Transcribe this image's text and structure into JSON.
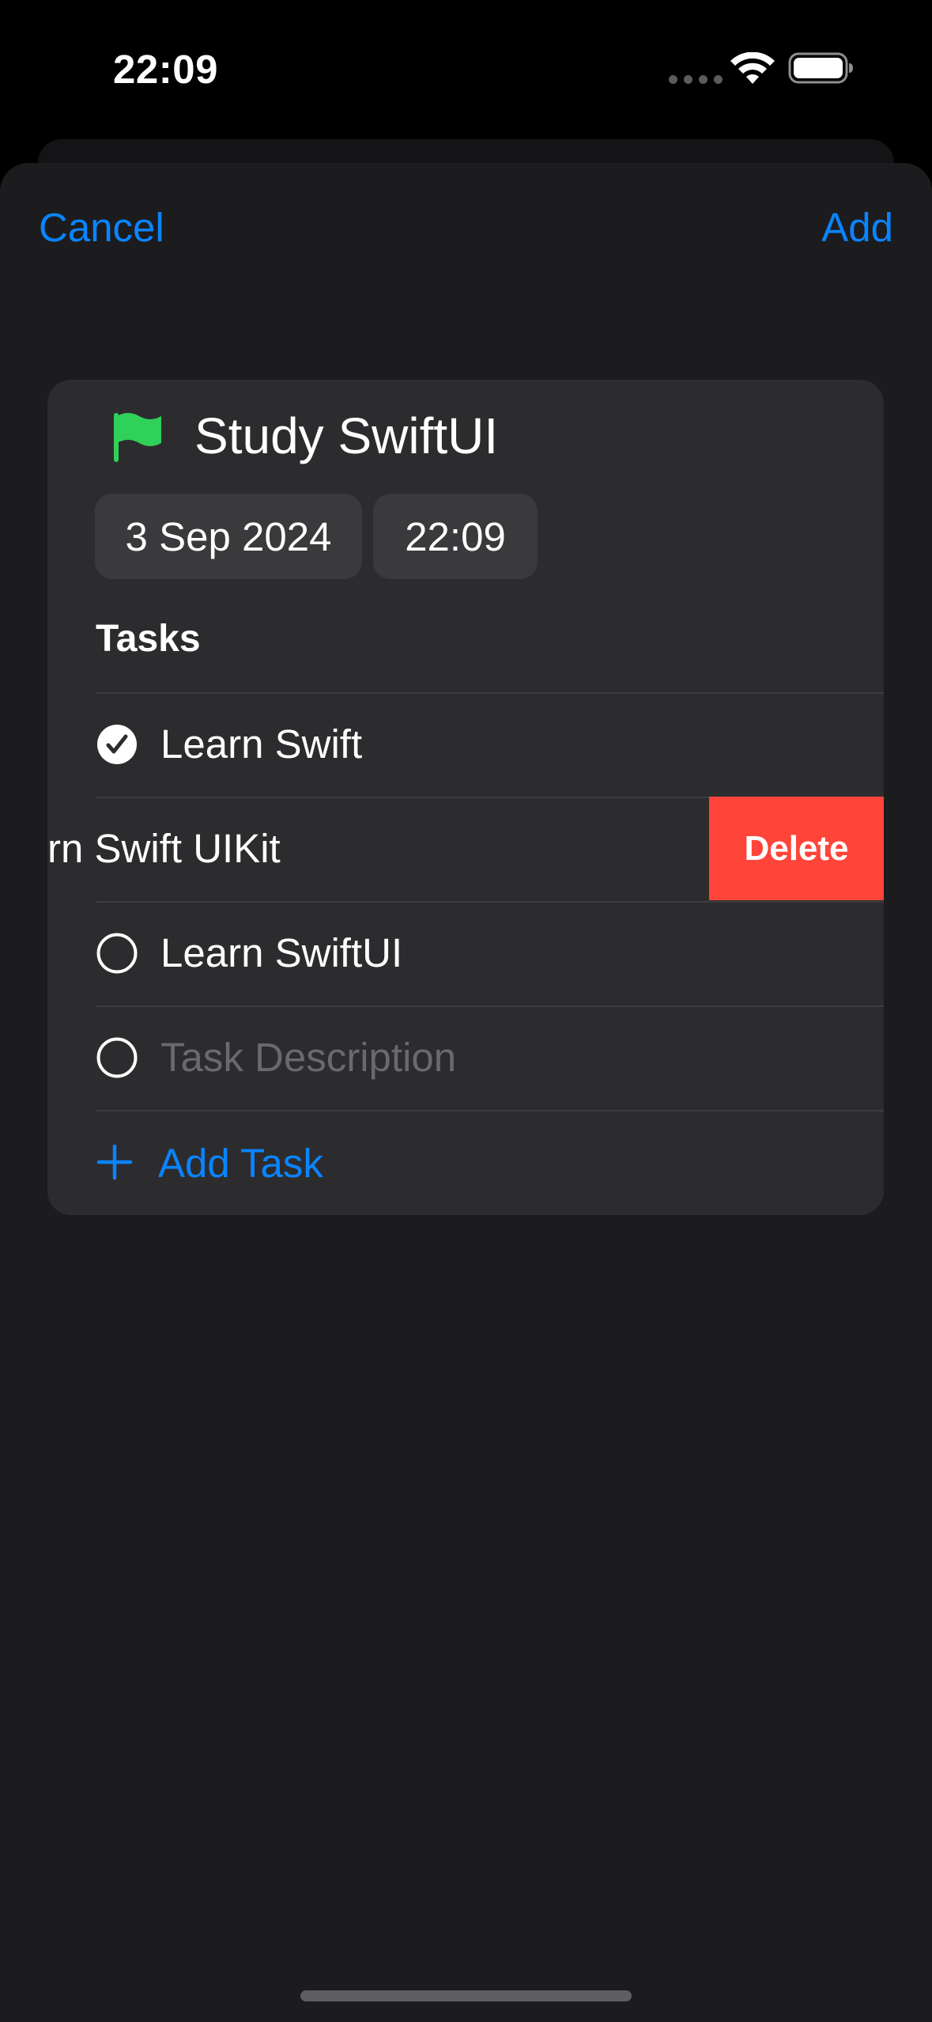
{
  "status_bar": {
    "time": "22:09",
    "icons": [
      "signal-dots-icon",
      "wifi-icon",
      "battery-icon"
    ]
  },
  "nav": {
    "cancel_label": "Cancel",
    "add_label": "Add"
  },
  "list": {
    "title": "Study SwiftUI",
    "flag_icon": "flag-icon",
    "flag_color": "#30d158",
    "date": "3 Sep 2024",
    "time": "22:09"
  },
  "tasks": {
    "section_title": "Tasks",
    "items": [
      {
        "label": "Learn Swift",
        "done": true
      },
      {
        "label": "rn Swift UIKit",
        "swiped": true,
        "delete_label": "Delete"
      },
      {
        "label": "Learn SwiftUI",
        "done": false
      }
    ],
    "new_task_placeholder": "Task Description",
    "add_task_label": "Add Task"
  },
  "colors": {
    "accent": "#0a84ff",
    "destructive": "#ff453a",
    "background": "#1c1c1e",
    "card": "#2c2c2e"
  }
}
